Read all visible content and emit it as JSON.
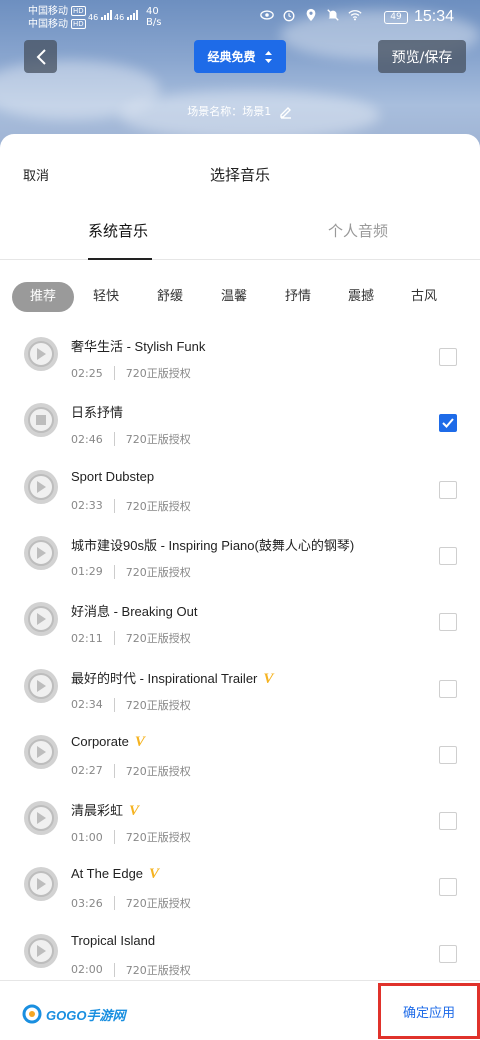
{
  "status_bar": {
    "carrier1": "中国移动",
    "carrier2": "中国移动",
    "hd": "HD",
    "net": "46",
    "speed_value": "40",
    "speed_unit": "B/s",
    "battery": "49",
    "time": "15:34"
  },
  "header": {
    "mode": "经典免费",
    "preview_save": "预览/保存",
    "scene_name": "场景名称：场景1"
  },
  "sheet": {
    "cancel": "取消",
    "title": "选择音乐",
    "tabs": [
      "系统音乐",
      "个人音频"
    ],
    "categories": [
      "推荐",
      "轻快",
      "舒缓",
      "温馨",
      "抒情",
      "震撼",
      "古风"
    ],
    "songs": [
      {
        "title": "奢华生活 - Stylish Funk",
        "vip": "",
        "duration": "02:25",
        "license": "720正版授权",
        "checked": false,
        "playing": false
      },
      {
        "title": "日系抒情",
        "vip": "",
        "duration": "02:46",
        "license": "720正版授权",
        "checked": true,
        "playing": true
      },
      {
        "title": "Sport Dubstep",
        "vip": "",
        "duration": "02:33",
        "license": "720正版授权",
        "checked": false,
        "playing": false
      },
      {
        "title": "城市建设90s版 - Inspiring Piano(鼓舞人心的钢琴)",
        "vip": "",
        "duration": "01:29",
        "license": "720正版授权",
        "checked": false,
        "playing": false
      },
      {
        "title": "好消息 - Breaking Out",
        "vip": "",
        "duration": "02:11",
        "license": "720正版授权",
        "checked": false,
        "playing": false
      },
      {
        "title": "最好的时代 - Inspirational Trailer",
        "vip": "V",
        "duration": "02:34",
        "license": "720正版授权",
        "checked": false,
        "playing": false
      },
      {
        "title": "Corporate",
        "vip": "V",
        "duration": "02:27",
        "license": "720正版授权",
        "checked": false,
        "playing": false
      },
      {
        "title": "清晨彩虹",
        "vip": "V",
        "duration": "01:00",
        "license": "720正版授权",
        "checked": false,
        "playing": false
      },
      {
        "title": "At The Edge",
        "vip": "V",
        "duration": "03:26",
        "license": "720正版授权",
        "checked": false,
        "playing": false
      },
      {
        "title": "Tropical Island",
        "vip": "",
        "duration": "02:00",
        "license": "720正版授权",
        "checked": false,
        "playing": false
      }
    ]
  },
  "footer": {
    "logo": "GOGO手游网",
    "confirm": "确定应用"
  },
  "colors": {
    "accent": "#1e6be8",
    "vip": "#f5b321",
    "highlight_box": "#e0322b"
  }
}
